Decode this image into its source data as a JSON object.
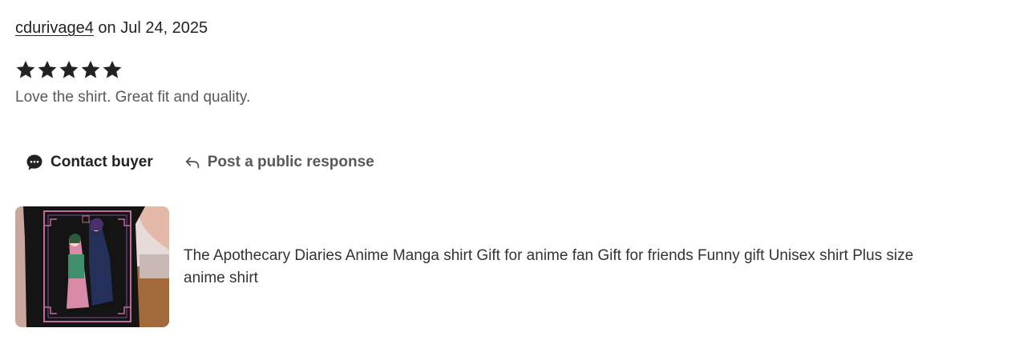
{
  "review": {
    "username": "cdurivage4",
    "date_text": " on Jul 24, 2025",
    "rating": 5,
    "rating_max": 5,
    "text": "Love the shirt. Great fit and quality."
  },
  "actions": {
    "contact_label": "Contact buyer",
    "contact_icon": "chat-bubble-icon",
    "public_label": "Post a public response",
    "public_icon": "reply-arrow-icon"
  },
  "listing": {
    "title": "The Apothecary Diaries Anime Manga shirt Gift for anime fan Gift for friends Funny gift Unisex shirt Plus size anime shirt"
  },
  "colors": {
    "text_primary": "#222222",
    "text_secondary": "#595959",
    "star": "#222222",
    "shirt": "#141414"
  }
}
